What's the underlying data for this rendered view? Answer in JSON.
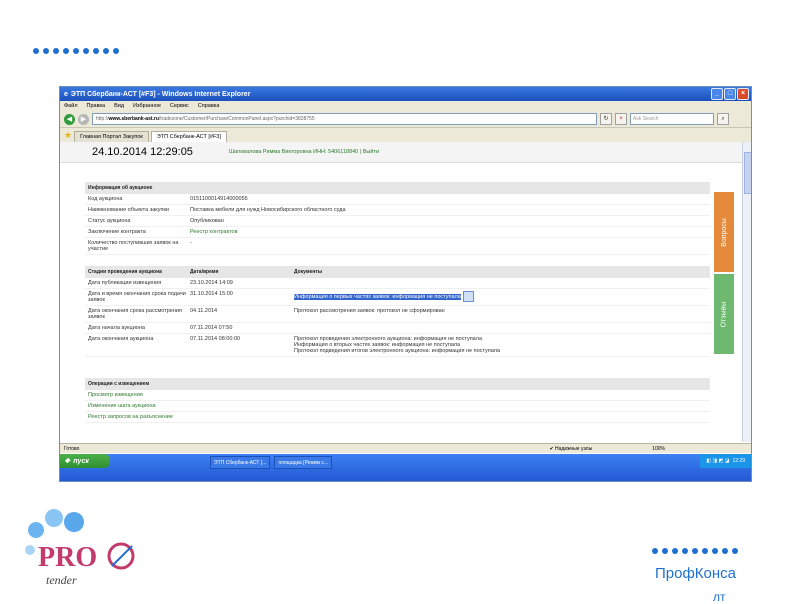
{
  "window": {
    "title": "ЭТП Сбербанк-АСТ [#F3] - Windows Internet Explorer"
  },
  "menu": [
    "Файл",
    "Правка",
    "Вид",
    "Избранное",
    "Сервис",
    "Справка"
  ],
  "address": {
    "host": "www.sberbank-ast.ru",
    "path": "/tradezone/Customer/PurchaseCommonPanel.aspx?purchid=3838755",
    "search_placeholder": "Ask Search"
  },
  "tabs": [
    "Главная Портал Закупок",
    "ЭТП Сбербанк-АСТ [#F3]"
  ],
  "header": {
    "date": "24.10.2014 12:29:05",
    "user": "Шаповалова Римма Викторовна ИНН: 5406118840",
    "logout": "Выйти"
  },
  "auction": {
    "section": "Информация об аукционе",
    "rows": [
      {
        "label": "Код аукциона",
        "value": "0151100014914000055"
      },
      {
        "label": "Наименование объекта закупки",
        "value": "Поставка мебели для нужд Новосибирского областного суда"
      },
      {
        "label": "Статус аукциона",
        "value": "Опубликован"
      },
      {
        "label": "Заключение контракта",
        "value": "Реестр контрактов"
      },
      {
        "label": "Количество поступивших заявок на участие",
        "value": "-"
      }
    ]
  },
  "stages": {
    "col1": "Стадии проведения аукциона",
    "col2": "Дата/время",
    "col3": "Документы",
    "rows": [
      {
        "label": "Дата публикации извещения",
        "date": "23.10.2014 14:09",
        "docs": []
      },
      {
        "label": "Дата и время окончания срока подачи заявок",
        "date": "31.10.2014 15:00",
        "docs": [
          "Информация о первых частях заявок: информация не поступала"
        ]
      },
      {
        "label": "Дата окончания срока рассмотрения заявок",
        "date": "04.11.2014",
        "docs": [
          "Протокол рассмотрения заявок: протокол не сформирован"
        ]
      },
      {
        "label": "Дата начала аукциона",
        "date": "07.11.2014 07:50",
        "docs": []
      },
      {
        "label": "Дата окончания аукциона",
        "date": "07.11.2014 08:00:00",
        "docs": [
          "Протокол проведения электронного аукциона: информация не поступала",
          "Информация о вторых частях заявок: информация не поступала",
          "Протокол подведения итогов электронного аукциона: информация не поступала"
        ]
      }
    ]
  },
  "operations": {
    "section": "Операции с извещением",
    "links": [
      "Просмотр извещения",
      "Изменение шага аукциона",
      "Реестр запросов на разъяснение"
    ]
  },
  "side_tabs": {
    "questions": "Вопросы",
    "reviews": "Отзывы"
  },
  "statusbar": {
    "left": "Готово",
    "zone": "Надежные узлы",
    "zoom": "100%"
  },
  "taskbar": {
    "start": "пуск",
    "apps": [
      "ЭТП Сбербанк-АСТ [...",
      "площадка [Режим с..."
    ],
    "clock": "12:29"
  },
  "brand": {
    "logo": "PRO tender",
    "name": "ПрофКонса",
    "name2": "лт"
  },
  "colors": {
    "accent": "#1e6fd0",
    "green_link": "#2f7a2f",
    "orange_tab": "#e58a3a",
    "green_tab": "#6fb86f"
  }
}
